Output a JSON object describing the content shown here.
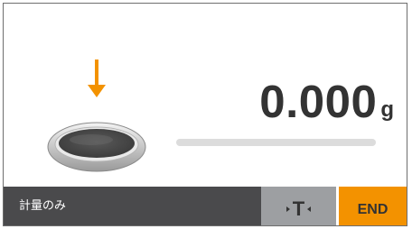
{
  "display": {
    "weight_value": "0.000",
    "weight_unit": "g",
    "capacity_fraction": 0
  },
  "footer": {
    "mode_label": "計量のみ",
    "tare_label": "T",
    "end_label": "END"
  },
  "icons": {
    "load_arrow": "down-arrow-icon",
    "weighing_pan": "weighing-pan-icon",
    "tare": "tare-icon"
  },
  "colors": {
    "accent": "#f39200",
    "footer_dark": "#4a4a4c",
    "tare_gray": "#9d9fa2",
    "text_dark": "#333333",
    "bar_track": "#dcdcdc"
  }
}
